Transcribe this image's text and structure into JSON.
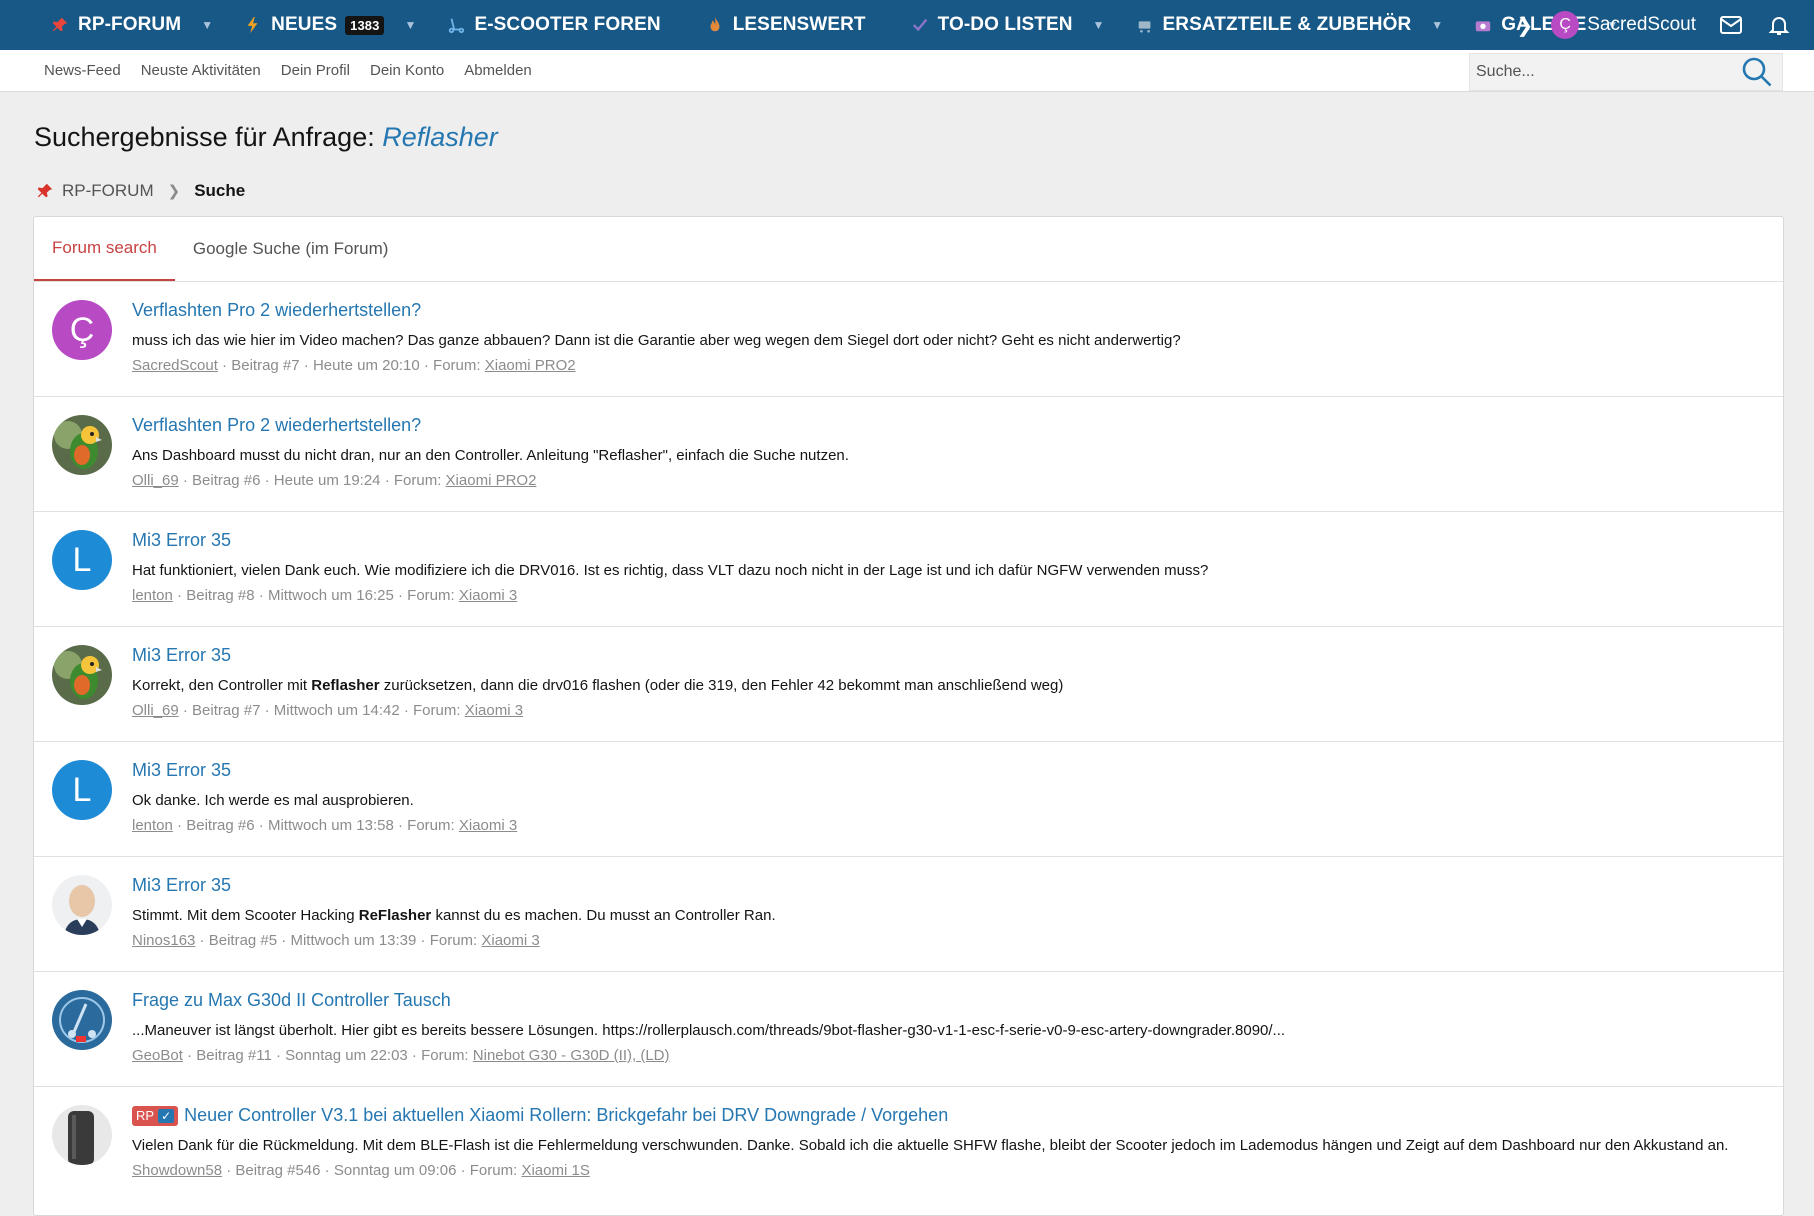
{
  "nav": {
    "items": [
      {
        "label": "RP-FORUM",
        "icon": "pin-icon",
        "caret": true
      },
      {
        "label": "NEUES",
        "icon": "lightning-icon",
        "badge": "1383",
        "caret": true
      },
      {
        "label": "E-SCOOTER FOREN",
        "icon": "scooter-icon",
        "caret": false
      },
      {
        "label": "LESENSWERT",
        "icon": "flame-icon",
        "caret": false
      },
      {
        "label": "TO-DO LISTEN",
        "icon": "checkmark-icon",
        "caret": true
      },
      {
        "label": "ERSATZTEILE & ZUBEHÖR",
        "icon": "cart-icon",
        "caret": true
      },
      {
        "label": "GALERIE",
        "icon": "camera-icon",
        "caret": true
      }
    ],
    "username": "SacredScout",
    "avatar_letter": "Ç"
  },
  "subnav": {
    "links": [
      "News-Feed",
      "Neuste Aktivitäten",
      "Dein Profil",
      "Dein Konto",
      "Abmelden"
    ],
    "search_placeholder": "Suche..."
  },
  "page": {
    "title_prefix": "Suchergebnisse für Anfrage:",
    "query": "Reflasher",
    "breadcrumb_home": "RP-FORUM",
    "breadcrumb_current": "Suche"
  },
  "tabs": [
    "Forum search",
    "Google Suche (im Forum)"
  ],
  "colors": {
    "accent": "#2577b1",
    "header": "#185886",
    "active_tab": "#c84242"
  },
  "results": [
    {
      "title": "Verflashten Pro 2 wiederhertstellen?",
      "snippet_pre": "muss ich das wie hier im Video machen? Das ganze abbauen? Dann ist die Garantie aber weg wegen dem Siegel dort oder nicht? Geht es nicht anderwertig?",
      "snippet_bold": "",
      "snippet_post": "",
      "user": "SacredScout",
      "post": "Beitrag #7",
      "time": "Heute um 20:10",
      "forum": "Xiaomi PRO2",
      "avatar": {
        "type": "letter",
        "letter": "Ç",
        "color": "#b84ac4"
      }
    },
    {
      "title": "Verflashten Pro 2 wiederhertstellen?",
      "snippet_pre": "Ans Dashboard musst du nicht dran, nur an den Controller. Anleitung \"Reflasher\", einfach die Suche nutzen.",
      "snippet_bold": "",
      "snippet_post": "",
      "user": "Olli_69",
      "post": "Beitrag #6",
      "time": "Heute um 19:24",
      "forum": "Xiaomi PRO2",
      "avatar": {
        "type": "parrot"
      }
    },
    {
      "title": "Mi3 Error 35",
      "snippet_pre": "Hat funktioniert, vielen Dank euch. Wie modifiziere ich die DRV016. Ist es richtig, dass VLT dazu noch nicht in der Lage ist und ich dafür NGFW verwenden muss?",
      "snippet_bold": "",
      "snippet_post": "",
      "user": "lenton",
      "post": "Beitrag #8",
      "time": "Mittwoch um 16:25",
      "forum": "Xiaomi 3",
      "avatar": {
        "type": "letter",
        "letter": "L",
        "color": "#1e8bd6"
      }
    },
    {
      "title": "Mi3 Error 35",
      "snippet_pre": "Korrekt, den Controller mit ",
      "snippet_bold": "Reflasher",
      "snippet_post": " zurücksetzen, dann die drv016 flashen (oder die 319, den Fehler 42 bekommt man anschließend weg)",
      "user": "Olli_69",
      "post": "Beitrag #7",
      "time": "Mittwoch um 14:42",
      "forum": "Xiaomi 3",
      "avatar": {
        "type": "parrot"
      }
    },
    {
      "title": "Mi3 Error 35",
      "snippet_pre": "Ok danke. Ich werde es mal ausprobieren.",
      "snippet_bold": "",
      "snippet_post": "",
      "user": "lenton",
      "post": "Beitrag #6",
      "time": "Mittwoch um 13:58",
      "forum": "Xiaomi 3",
      "avatar": {
        "type": "letter",
        "letter": "L",
        "color": "#1e8bd6"
      }
    },
    {
      "title": "Mi3 Error 35",
      "snippet_pre": "Stimmt. Mit dem Scooter Hacking ",
      "snippet_bold": "ReFlasher",
      "snippet_post": " kannst du es machen. Du musst an Controller Ran.",
      "user": "Ninos163",
      "post": "Beitrag #5",
      "time": "Mittwoch um 13:39",
      "forum": "Xiaomi 3",
      "avatar": {
        "type": "person"
      }
    },
    {
      "title": "Frage zu Max G30d II Controller Tausch",
      "snippet_pre": "...Maneuver ist längst überholt. Hier gibt es bereits bessere Lösungen. https://rollerplausch.com/threads/9bot-flasher-g30-v1-1-esc-f-serie-v0-9-esc-artery-downgrader.8090/...",
      "snippet_bold": "",
      "snippet_post": "",
      "user": "GeoBot",
      "post": "Beitrag #11",
      "time": "Sonntag um 22:03",
      "forum": "Ninebot G30 - G30D (II), (LD)",
      "avatar": {
        "type": "bot"
      }
    },
    {
      "title": "Neuer Controller V3.1 bei aktuellen Xiaomi Rollern: Brickgefahr bei DRV Downgrade / Vorgehen",
      "prefix": "RP",
      "snippet_pre": "Vielen Dank für die Rückmeldung. Mit dem BLE-Flash ist die Fehlermeldung verschwunden. Danke. Sobald ich die aktuelle SHFW flashe, bleibt der Scooter jedoch im Lademodus hängen und Zeigt auf dem Dashboard nur den Akkustand an.",
      "snippet_bold": "",
      "snippet_post": "",
      "user": "Showdown58",
      "post": "Beitrag #546",
      "time": "Sonntag um 09:06",
      "forum": "Xiaomi 1S",
      "avatar": {
        "type": "dark"
      }
    }
  ]
}
